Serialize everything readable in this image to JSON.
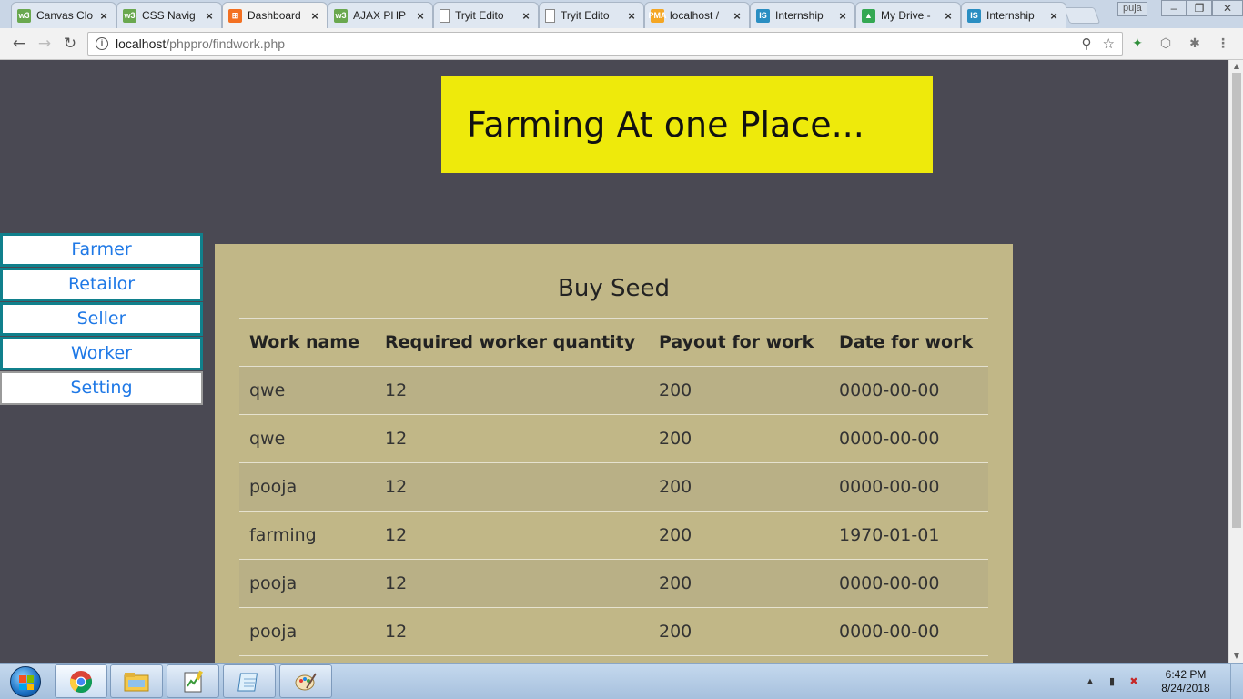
{
  "browser": {
    "tabs": [
      {
        "title": "Canvas Clo",
        "icon": "w3schools-icon",
        "icon_text": "w3",
        "icon_color": "#6aa84f"
      },
      {
        "title": "CSS Navig",
        "icon": "w3schools-icon",
        "icon_text": "w3",
        "icon_color": "#6aa84f"
      },
      {
        "title": "Dashboard",
        "icon": "xampp-icon",
        "icon_text": "⊞",
        "icon_color": "#f37021",
        "active": true
      },
      {
        "title": "AJAX PHP",
        "icon": "w3schools-icon",
        "icon_text": "w3",
        "icon_color": "#6aa84f"
      },
      {
        "title": "Tryit Edito",
        "icon": "page-icon",
        "icon_text": "",
        "icon_color": "#ffffff"
      },
      {
        "title": "Tryit Edito",
        "icon": "page-icon",
        "icon_text": "",
        "icon_color": "#ffffff"
      },
      {
        "title": "localhost /",
        "icon": "phpmyadmin-icon",
        "icon_text": "PMA",
        "icon_color": "#f4a623"
      },
      {
        "title": "Internship",
        "icon": "internshala-icon",
        "icon_text": "IS",
        "icon_color": "#2a8ec2"
      },
      {
        "title": "My Drive -",
        "icon": "google-drive-icon",
        "icon_text": "▲",
        "icon_color": "#34a853"
      },
      {
        "title": "Internship",
        "icon": "internshala-icon",
        "icon_text": "IS",
        "icon_color": "#2a8ec2"
      }
    ],
    "close_glyph": "×",
    "user": "puja",
    "url_host": "localhost",
    "url_path": "/phppro/findwork.php"
  },
  "page": {
    "banner_title": "Farming At one Place...",
    "nav": [
      {
        "label": "Farmer"
      },
      {
        "label": "Retailor"
      },
      {
        "label": "Seller"
      },
      {
        "label": "Worker"
      },
      {
        "label": "Setting"
      }
    ],
    "panel_title": "Buy Seed",
    "table": {
      "headers": [
        "Work name",
        "Required worker quantity",
        "Payout for work",
        "Date for work"
      ],
      "rows": [
        [
          "qwe",
          "12",
          "200",
          "0000-00-00"
        ],
        [
          "qwe",
          "12",
          "200",
          "0000-00-00"
        ],
        [
          "pooja",
          "12",
          "200",
          "0000-00-00"
        ],
        [
          "farming",
          "12",
          "200",
          "1970-01-01"
        ],
        [
          "pooja",
          "12",
          "200",
          "0000-00-00"
        ],
        [
          "pooja",
          "12",
          "200",
          "0000-00-00"
        ]
      ]
    },
    "colors": {
      "background": "#4a4953",
      "banner": "#eeea0b",
      "panel": "#c1b787",
      "nav_border": "#10808c",
      "nav_text": "#1e78e6"
    }
  },
  "taskbar": {
    "apps": [
      "chrome-icon",
      "file-explorer-icon",
      "notepad-plus-icon",
      "notepad-icon",
      "paint-icon"
    ],
    "time": "6:42 PM",
    "date": "8/24/2018"
  }
}
